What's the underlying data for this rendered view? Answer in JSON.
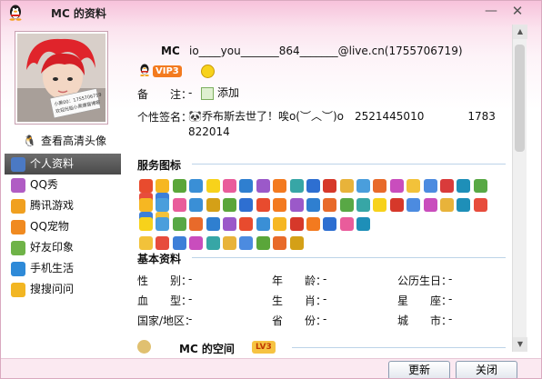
{
  "window": {
    "title": "MC 的资料",
    "minimize_glyph": "—",
    "close_glyph": "✕"
  },
  "left": {
    "avatar_caption_1": "小黑00：1755706719",
    "avatar_caption_2": "欢迎光临小黑爆居博客",
    "hd_avatar_link": "查看高清头像",
    "nav": [
      {
        "label": "个人资料",
        "icon": "person-card-icon",
        "color": "#4b79c4",
        "active": true
      },
      {
        "label": "QQ秀",
        "icon": "qq-show-icon",
        "color": "#b05cc4",
        "active": false
      },
      {
        "label": "腾讯游戏",
        "icon": "game-icon",
        "color": "#f0a020",
        "active": false
      },
      {
        "label": "QQ宠物",
        "icon": "pet-icon",
        "color": "#f08a20",
        "active": false
      },
      {
        "label": "好友印象",
        "icon": "friend-impression-icon",
        "color": "#6fb348",
        "active": false
      },
      {
        "label": "手机生活",
        "icon": "mobile-life-icon",
        "color": "#2e8ad8",
        "active": false
      },
      {
        "label": "搜搜问问",
        "icon": "soso-ask-icon",
        "color": "#f2b623",
        "active": false
      }
    ]
  },
  "profile": {
    "nickname": "MC",
    "email": "io____you_______864_______@live.cn(1755706719)",
    "vip_level": "VIP3",
    "remark_label": "备　　注：",
    "remark_value": "-",
    "remark_add": "添加",
    "signature_label": "个性签名：",
    "signature": "🐼乔布斯去世了！唉o(︶︿︶)o　2521445010　　　　1783822014"
  },
  "service_icons": {
    "title": "服务图标",
    "rows": [
      [
        "#e84b2e",
        "#f6b722",
        "#5aa63a",
        "#3a8fd6",
        "#f7d21b",
        "#e95c9b",
        "#2f7fd0",
        "#9b59c9",
        "#f37a1f",
        "#37a6a6",
        "#2e6fd1",
        "#d6382a",
        "#e8b33a",
        "#4a9edc",
        "#e86a2a",
        "#c94dbd",
        "#f2c23a",
        "#4c8be0",
        "#d93b3b",
        "#1e8fb8",
        "#58a845",
        "#e74c3c",
        "#3d7fd8"
      ],
      [
        "#f6b722",
        "#4a9edc",
        "#e95c9b",
        "#3a8fd6",
        "#d4a017",
        "#5aa63a",
        "#2e6fd1",
        "#e84b2e",
        "#f37a1f",
        "#9b59c9",
        "#2f7fd0",
        "#e86a2a",
        "#58a845",
        "#37a6a6",
        "#f7d21b",
        "#d6382a",
        "#4c8be0",
        "#c94dbd",
        "#e8b33a",
        "#1e8fb8",
        "#e74c3c",
        "#3d7fd8",
        "#f2c23a"
      ],
      [
        "#f7d21b",
        "#4a9edc",
        "#58a845",
        "#e86a2a",
        "#2f7fd0",
        "#9b59c9",
        "#e84b2e",
        "#3a8fd6",
        "#f6b722",
        "#d6382a",
        "#f37a1f",
        "#2e6fd1",
        "#e95c9b",
        "#1e8fb8"
      ],
      [
        "#f2c23a",
        "#e74c3c",
        "#3d7fd8",
        "#c94dbd",
        "#37a6a6",
        "#e8b33a",
        "#4c8be0",
        "#5aa63a",
        "#e86a2a",
        "#d4a017"
      ]
    ]
  },
  "basic_info": {
    "title": "基本资料",
    "rows": [
      [
        {
          "label": "性　　别：",
          "value": "-"
        },
        {
          "label": "年　　龄：",
          "value": "-"
        },
        {
          "label": "公历生日：",
          "value": "-"
        }
      ],
      [
        {
          "label": "血　　型：",
          "value": "-"
        },
        {
          "label": "生　　肖：",
          "value": "-"
        },
        {
          "label": "星　　座：",
          "value": "-"
        }
      ],
      [
        {
          "label": "国家/地区：",
          "value": "-"
        },
        {
          "label": "省　　份：",
          "value": "-"
        },
        {
          "label": "城　　市：",
          "value": "-"
        }
      ]
    ]
  },
  "space": {
    "label": "MC 的空间",
    "level": "LV3"
  },
  "buttons": {
    "refresh": "更新",
    "close": "关闭"
  }
}
